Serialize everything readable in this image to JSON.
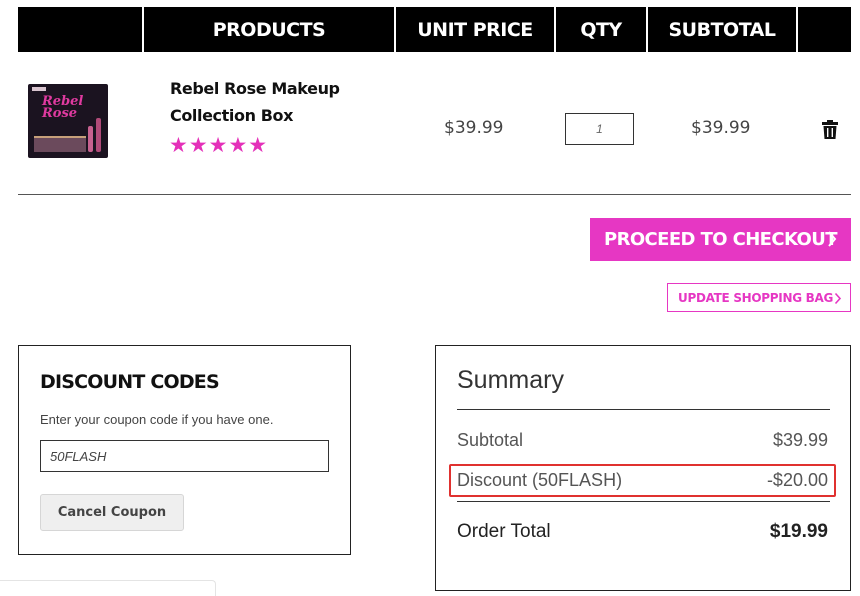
{
  "table_header": {
    "products": "PRODUCTS",
    "unit_price": "UNIT PRICE",
    "qty": "QTY",
    "subtotal": "SUBTOTAL"
  },
  "item": {
    "name": "Rebel Rose Makeup Collection Box",
    "image_label": "Rebel Rose",
    "rating_stars": 5,
    "stars_text": "★★★★★",
    "unit_price": "$39.99",
    "qty_value": "1",
    "subtotal": "$39.99",
    "remove_icon": "trash-icon"
  },
  "actions": {
    "checkout_label": "PROCEED TO CHECKOUT",
    "update_label": "UPDATE SHOPPING BAG"
  },
  "discount": {
    "title": "DISCOUNT CODES",
    "help_text": "Enter your coupon code if you have one.",
    "code_value": "50FLASH",
    "cancel_label": "Cancel Coupon"
  },
  "summary": {
    "title": "Summary",
    "subtotal_label": "Subtotal",
    "subtotal_value": "$39.99",
    "discount_label": "Discount (50FLASH)",
    "discount_value": "-$20.00",
    "total_label": "Order Total",
    "total_value": "$19.99"
  },
  "colors": {
    "accent": "#e637c3",
    "header_bg": "#000000",
    "highlight": "#e0312f"
  }
}
